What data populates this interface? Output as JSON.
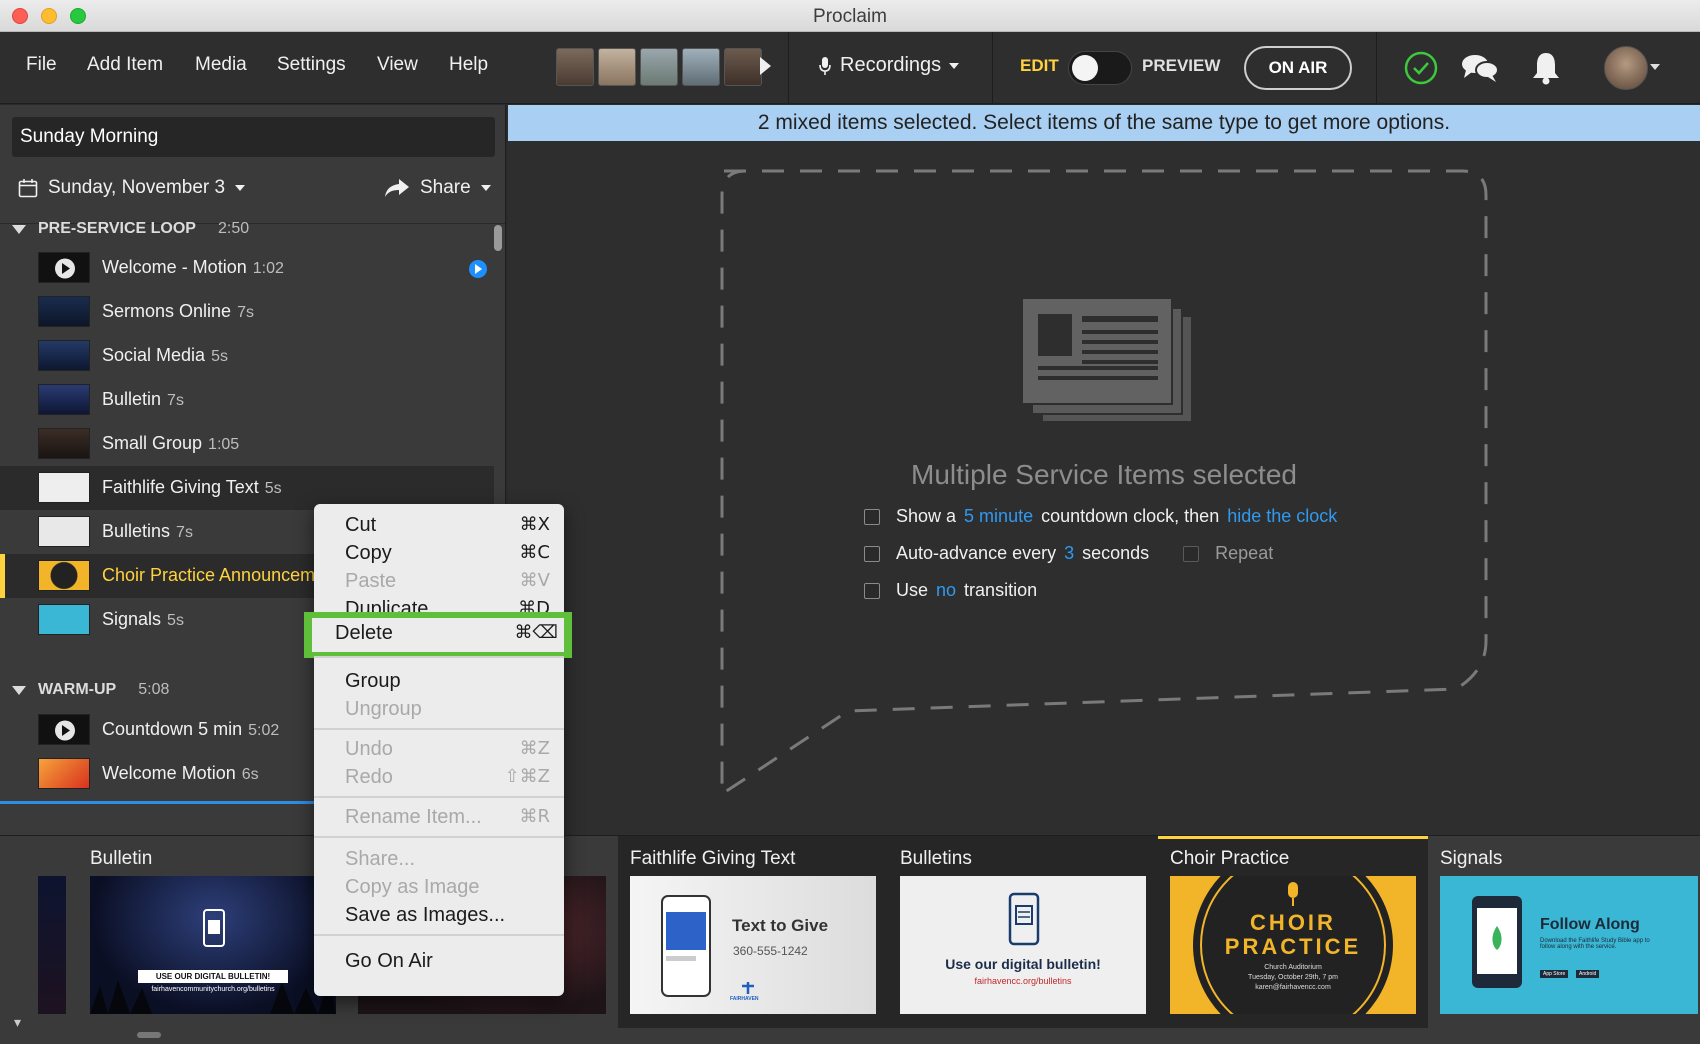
{
  "window": {
    "title": "Proclaim"
  },
  "menu": [
    "File",
    "Add Item",
    "Media",
    "Settings",
    "View",
    "Help"
  ],
  "toolbar": {
    "recordings_label": "Recordings",
    "edit_label": "EDIT",
    "preview_label": "PREVIEW",
    "on_air_label": "ON AIR",
    "mode": "edit",
    "colors": {
      "edit": "#ffd23e",
      "status_ok": "#3dc93b"
    }
  },
  "service": {
    "name": "Sunday Morning",
    "date": "Sunday, November 3",
    "share_label": "Share"
  },
  "sections": [
    {
      "name": "PRE-SERVICE LOOP",
      "duration": "2:50"
    },
    {
      "name": "WARM-UP",
      "duration": "5:08"
    }
  ],
  "items": [
    {
      "name": "Welcome - Motion",
      "duration": "1:02"
    },
    {
      "name": "Sermons Online",
      "duration": "7s"
    },
    {
      "name": "Social Media",
      "duration": "5s"
    },
    {
      "name": "Bulletin",
      "duration": "7s"
    },
    {
      "name": "Small Group",
      "duration": "1:05"
    },
    {
      "name": "Faithlife Giving Text",
      "duration": "5s"
    },
    {
      "name": "Bulletins",
      "duration": "7s"
    },
    {
      "name": "Choir Practice Announcem",
      "duration": ""
    },
    {
      "name": "Signals",
      "duration": "5s"
    }
  ],
  "warmup_items": [
    {
      "name": "Countdown 5 min",
      "duration": "5:02"
    },
    {
      "name": "Welcome Motion",
      "duration": "6s"
    }
  ],
  "banner": "2 mixed items selected. Select items of the same type to get more options.",
  "main": {
    "title": "Multiple Service Items selected",
    "opt1": {
      "a": "Show a",
      "b": "5 minute",
      "c": "countdown clock, then",
      "d": "hide the clock"
    },
    "opt2": {
      "a": "Auto-advance every",
      "b": "3",
      "c": "seconds",
      "repeat": "Repeat"
    },
    "opt3": {
      "a": "Use",
      "b": "no",
      "c": "transition"
    }
  },
  "context_menu": [
    {
      "label": "Cut",
      "shortcut": "⌘X",
      "enabled": true
    },
    {
      "label": "Copy",
      "shortcut": "⌘C",
      "enabled": true
    },
    {
      "label": "Paste",
      "shortcut": "⌘V",
      "enabled": false
    },
    {
      "label": "Duplicate",
      "shortcut": "⌘D",
      "enabled": true
    },
    {
      "label": "Delete",
      "shortcut": "⌘⌫",
      "enabled": true
    },
    {
      "label": "Group",
      "shortcut": "",
      "enabled": true
    },
    {
      "label": "Ungroup",
      "shortcut": "",
      "enabled": false
    },
    {
      "label": "Undo",
      "shortcut": "⌘Z",
      "enabled": false
    },
    {
      "label": "Redo",
      "shortcut": "⇧⌘Z",
      "enabled": false
    },
    {
      "label": "Rename Item...",
      "shortcut": "⌘R",
      "enabled": false
    },
    {
      "label": "Share...",
      "shortcut": "",
      "enabled": false
    },
    {
      "label": "Copy as Image",
      "shortcut": "",
      "enabled": false
    },
    {
      "label": "Save as Images...",
      "shortcut": "",
      "enabled": true
    },
    {
      "label": "Go On Air",
      "shortcut": "",
      "enabled": true
    }
  ],
  "bottom_cards": [
    {
      "title": "Bulletin",
      "headline": "USE OUR DIGITAL BULLETIN!",
      "sub": "fairhavencommunitychurch.org/bulletins"
    },
    {
      "title": "Faithlife Giving Text",
      "headline": "Text to Give",
      "sub": "360-555-1242",
      "brand": "FAIRHAVEN"
    },
    {
      "title": "Bulletins",
      "headline": "Use our digital bulletin!",
      "sub": "fairhavencc.org/bulletins"
    },
    {
      "title": "Choir Practice",
      "headline1": "CHOIR",
      "headline2": "PRACTICE",
      "sub1": "Church Auditorium",
      "sub2": "Tuesday, October 29th, 7 pm",
      "sub3": "karen@fairhavencc.com"
    },
    {
      "title": "Signals",
      "headline": "Follow Along",
      "sub": "Download the Faithlife Study Bible app to follow along with the service.",
      "store1": "App Store",
      "store2": "Android"
    }
  ]
}
